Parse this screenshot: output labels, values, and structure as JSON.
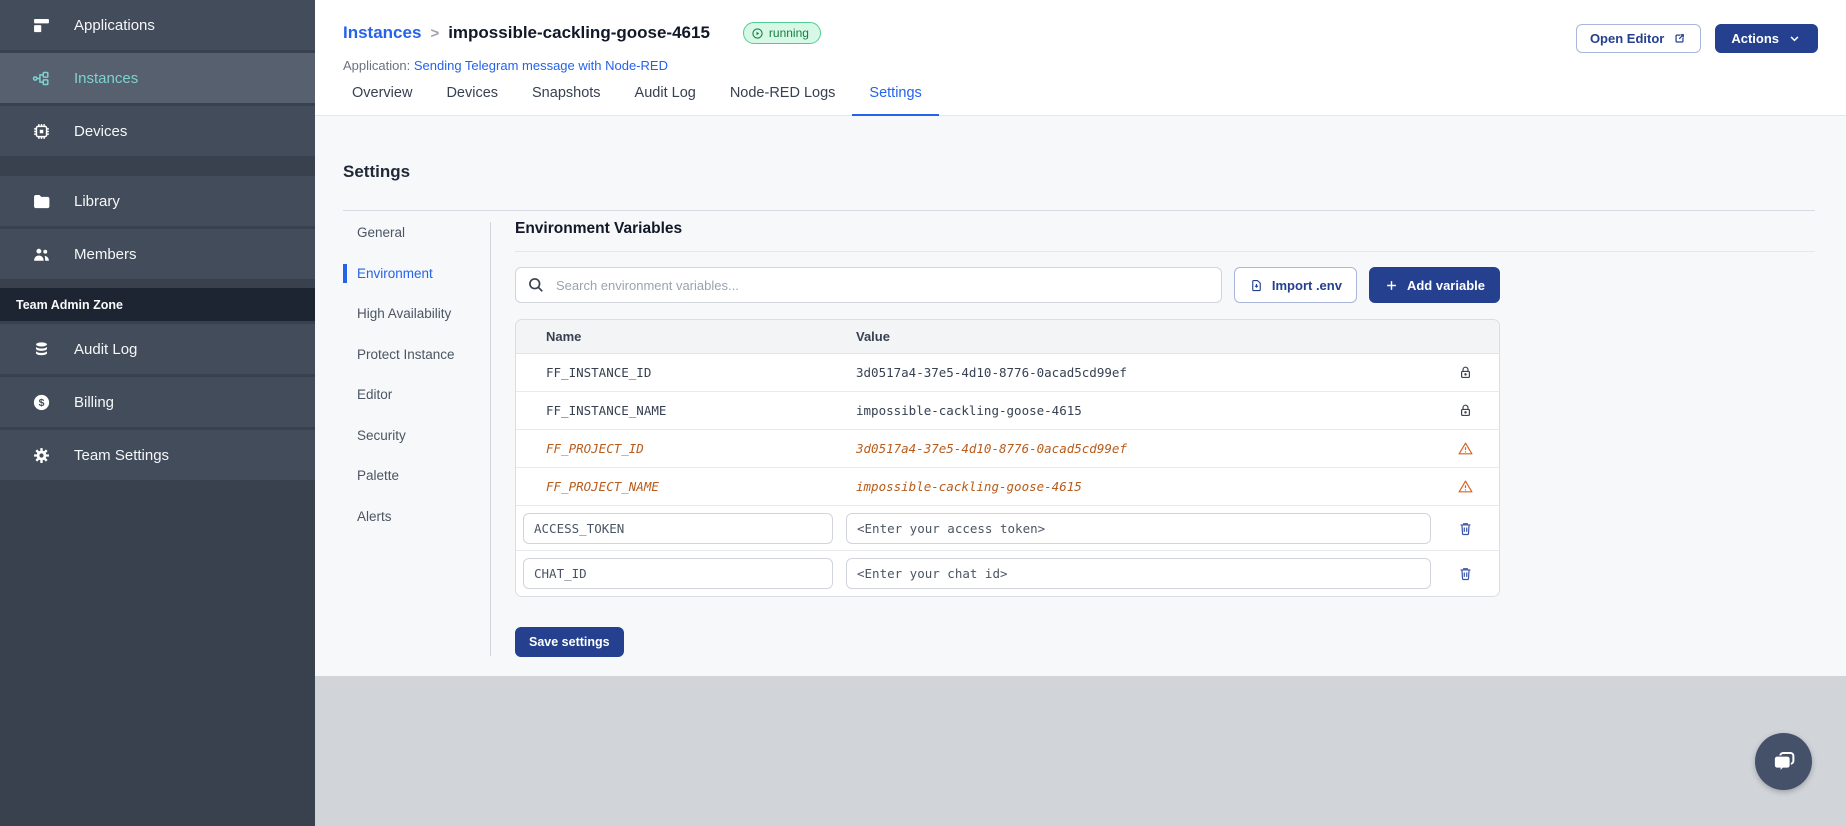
{
  "sidebar": {
    "items": [
      {
        "label": "Applications"
      },
      {
        "label": "Instances",
        "active": true
      },
      {
        "label": "Devices"
      },
      {
        "label": "Library"
      },
      {
        "label": "Members"
      }
    ],
    "admin_zone_label": "Team Admin Zone",
    "admin_items": [
      {
        "label": "Audit Log"
      },
      {
        "label": "Billing"
      },
      {
        "label": "Team Settings"
      }
    ]
  },
  "header": {
    "breadcrumb_parent": "Instances",
    "breadcrumb_separator": ">",
    "instance_name": "impossible-cackling-goose-4615",
    "status_badge": "running",
    "application_label": "Application:",
    "application_link": "Sending Telegram message with Node-RED",
    "open_editor_label": "Open Editor",
    "actions_label": "Actions"
  },
  "tabs": {
    "items": [
      {
        "label": "Overview"
      },
      {
        "label": "Devices"
      },
      {
        "label": "Snapshots"
      },
      {
        "label": "Audit Log"
      },
      {
        "label": "Node-RED Logs"
      },
      {
        "label": "Settings",
        "active": true
      }
    ]
  },
  "settings": {
    "title": "Settings",
    "nav": [
      {
        "label": "General"
      },
      {
        "label": "Environment",
        "active": true
      },
      {
        "label": "High Availability"
      },
      {
        "label": "Protect Instance"
      },
      {
        "label": "Editor"
      },
      {
        "label": "Security"
      },
      {
        "label": "Palette"
      },
      {
        "label": "Alerts"
      }
    ]
  },
  "environment": {
    "title": "Environment Variables",
    "search_placeholder": "Search environment variables...",
    "import_button": "Import .env",
    "add_button": "Add variable",
    "table": {
      "columns": [
        "Name",
        "Value"
      ],
      "rows": [
        {
          "name": "FF_INSTANCE_ID",
          "value": "3d0517a4-37e5-4d10-8776-0acad5cd99ef",
          "state": "locked"
        },
        {
          "name": "FF_INSTANCE_NAME",
          "value": "impossible-cackling-goose-4615",
          "state": "locked"
        },
        {
          "name": "FF_PROJECT_ID",
          "value": "3d0517a4-37e5-4d10-8776-0acad5cd99ef",
          "state": "deprecated"
        },
        {
          "name": "FF_PROJECT_NAME",
          "value": "impossible-cackling-goose-4615",
          "state": "deprecated"
        },
        {
          "name": "ACCESS_TOKEN",
          "value": "<Enter your access token>",
          "state": "editable"
        },
        {
          "name": "CHAT_ID",
          "value": "<Enter your chat id>",
          "state": "editable"
        }
      ]
    },
    "save_button": "Save settings"
  },
  "colors": {
    "accent_blue": "#2563eb",
    "navy_button": "#24408f",
    "sidebar_bg": "#39414f",
    "sidebar_item_bg": "#434c5a",
    "sidebar_active_bg": "#57606e",
    "sidebar_active_text": "#7dd3cf",
    "admin_zone_bg": "#1d2532",
    "status_running_bg": "#d7f8e7",
    "status_running_border": "#4fce8e",
    "status_running_text": "#15803d",
    "deprecated_text": "#b85c1c",
    "warning_icon": "#d9641e",
    "footer_band": "#d1d5da"
  }
}
